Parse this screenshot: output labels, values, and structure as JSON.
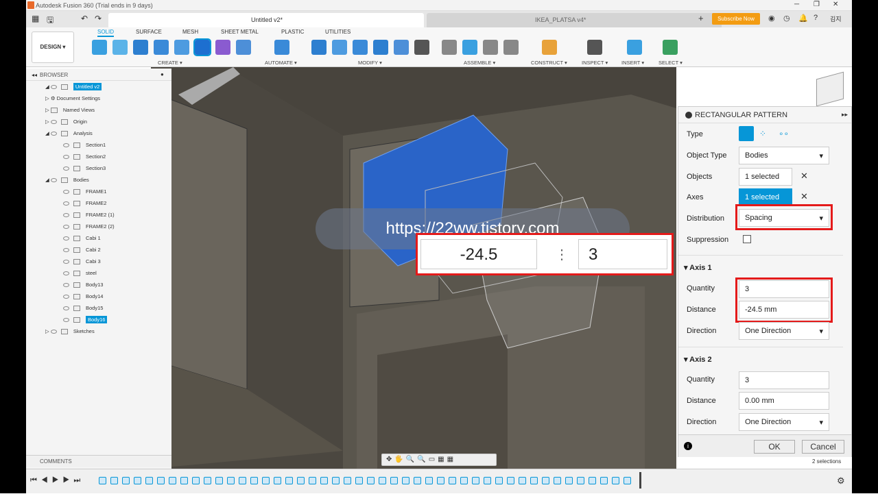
{
  "title": "Autodesk Fusion 360 (Trial ends in 9 days)",
  "tabs": {
    "doc1": "Untitled v2*",
    "doc2": "IKEA_PLATSA v4*",
    "subscribe": "Subscribe Now",
    "user": "김지"
  },
  "toolbar": {
    "design": "DESIGN ▾",
    "tabs": [
      "SOLID",
      "SURFACE",
      "MESH",
      "SHEET METAL",
      "PLASTIC",
      "UTILITIES"
    ],
    "groups": [
      "CREATE ▾",
      "AUTOMATE ▾",
      "MODIFY ▾",
      "ASSEMBLE ▾",
      "CONSTRUCT ▾",
      "INSPECT ▾",
      "INSERT ▾",
      "SELECT ▾"
    ]
  },
  "browser": {
    "header": "BROWSER",
    "items": [
      "Untitled v2",
      "Document Settings",
      "Named Views",
      "Origin",
      "Analysis",
      "Section1",
      "Section2",
      "Section3",
      "Bodies",
      "FRAME1",
      "FRAME2",
      "FRAME2 (1)",
      "FRAME2 (2)",
      "Cabi 1",
      "Cabi 2",
      "Cabi 3",
      "steel",
      "Body13",
      "Body14",
      "Body15",
      "Body16",
      "Sketches"
    ]
  },
  "comments": "COMMENTS",
  "watermark": "https://22ww.tistory.com",
  "callout": {
    "distance": "-24.5",
    "quantity": "3"
  },
  "panel": {
    "title": "RECTANGULAR PATTERN",
    "type_label": "Type",
    "object_type_label": "Object Type",
    "object_type": "Bodies",
    "objects_label": "Objects",
    "objects": "1 selected",
    "axes_label": "Axes",
    "axes": "1 selected",
    "distribution_label": "Distribution",
    "distribution": "Spacing",
    "suppression_label": "Suppression",
    "axis1": "Axis 1",
    "quantity_label": "Quantity",
    "q1": "3",
    "distance_label": "Distance",
    "d1": "-24.5 mm",
    "direction_label": "Direction",
    "dir1": "One Direction",
    "axis2": "Axis 2",
    "q2": "3",
    "d2": "0.00 mm",
    "dir2": "One Direction",
    "ok": "OK",
    "cancel": "Cancel",
    "selections": "2 selections"
  }
}
